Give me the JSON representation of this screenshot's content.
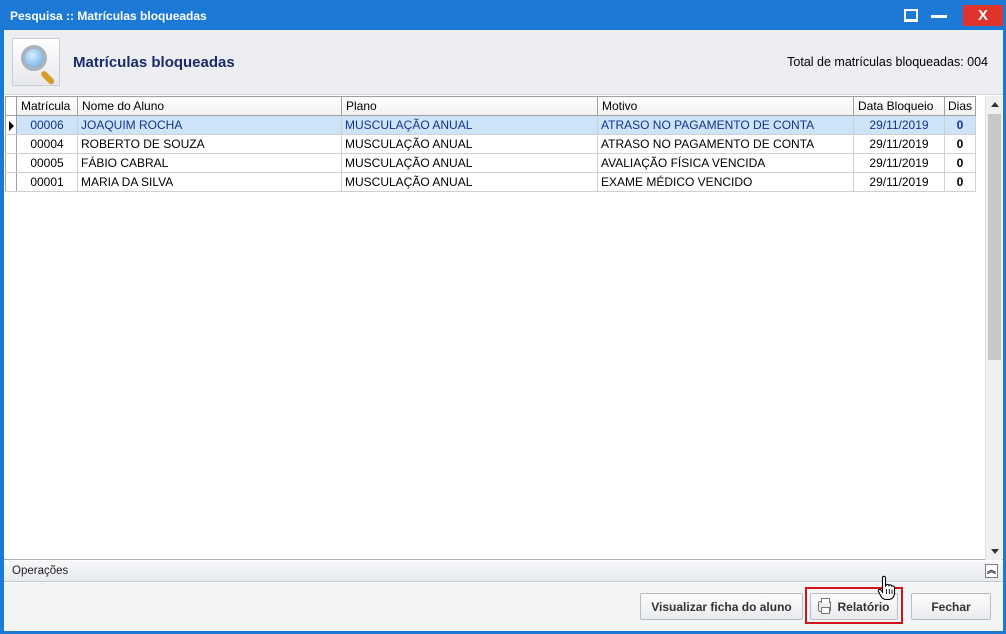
{
  "window": {
    "title": "Pesquisa :: Matrículas bloqueadas",
    "close_label": "X"
  },
  "header": {
    "title": "Matrículas bloqueadas",
    "total_label": "Total de matrículas bloqueadas: 004"
  },
  "grid": {
    "columns": [
      "Matrícula",
      "Nome do Aluno",
      "Plano",
      "Motivo",
      "Data Bloqueio",
      "Dias"
    ],
    "rows": [
      {
        "matricula": "00006",
        "nome": "JOAQUIM ROCHA",
        "plano": "MUSCULAÇÃO ANUAL",
        "motivo": "ATRASO NO PAGAMENTO DE CONTA",
        "data": "29/11/2019",
        "dias": "0"
      },
      {
        "matricula": "00004",
        "nome": "ROBERTO DE SOUZA",
        "plano": "MUSCULAÇÃO ANUAL",
        "motivo": "ATRASO NO PAGAMENTO DE CONTA",
        "data": "29/11/2019",
        "dias": "0"
      },
      {
        "matricula": "00005",
        "nome": "FÁBIO CABRAL",
        "plano": "MUSCULAÇÃO ANUAL",
        "motivo": "AVALIAÇÃO FÍSICA VENCIDA",
        "data": "29/11/2019",
        "dias": "0"
      },
      {
        "matricula": "00001",
        "nome": "MARIA DA SILVA",
        "plano": "MUSCULAÇÃO ANUAL",
        "motivo": "EXAME MÉDICO VENCIDO",
        "data": "29/11/2019",
        "dias": "0"
      }
    ]
  },
  "operations": {
    "label": "Operações"
  },
  "footer": {
    "ficha_label": "Visualizar ficha do aluno",
    "relatorio_label": "Relatório",
    "fechar_label": "Fechar"
  },
  "colors": {
    "titlebar": "#1c7ad6",
    "close": "#e0332b",
    "selected_row": "#cde4f8",
    "highlight": "#d4141c"
  }
}
